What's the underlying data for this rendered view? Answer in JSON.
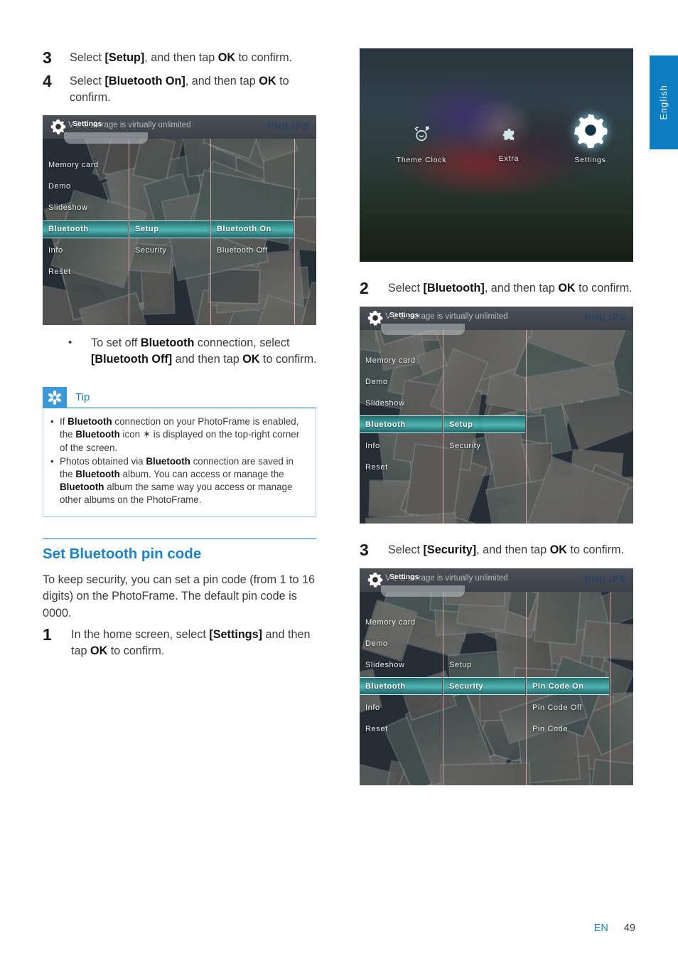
{
  "language_tab": {
    "label": "English"
  },
  "footer": {
    "lang_code": "EN",
    "page_number": "49"
  },
  "left_column": {
    "steps": [
      {
        "num": "3",
        "html": "Select <b>[Setup]</b>, and then tap <b>OK</b> to confirm."
      },
      {
        "num": "4",
        "html": "Select <b>[Bluetooth On]</b>, and then tap <b>OK</b> to confirm."
      }
    ],
    "screenshot_1": {
      "titlebar": {
        "background_text": "V      2 S        storage is virtually unlimited",
        "breadcrumb": "Settings",
        "brand": "PHILIPS",
        "icon": "gear-icon"
      },
      "column_1": [
        "Memory card",
        "Demo",
        "Slideshow",
        "Bluetooth",
        "Info",
        "Reset"
      ],
      "column_1_selected": "Bluetooth",
      "column_2": [
        "Setup",
        "Security"
      ],
      "column_2_selected": "Setup",
      "column_3": [
        "Bluetooth On",
        "Bluetooth Off"
      ],
      "column_3_selected": "Bluetooth On"
    },
    "sub_bullet": {
      "marker": "•",
      "html": "To set off <b>Bluetooth</b> connection, select <b>[Bluetooth Off]</b> and then tap <b>OK</b> to confirm."
    },
    "tip": {
      "icon": "asterisk-icon",
      "title": "Tip",
      "items": [
        "If <b>Bluetooth</b> connection on your PhotoFrame is enabled, the <b>Bluetooth</b> icon ✶ is displayed on the top-right corner of the screen.",
        "Photos obtained via <b>Bluetooth</b> connection are saved in the <b>Bluetooth</b> album. You can access or manage the <b>Bluetooth</b> album the same way you access or manage other albums on the PhotoFrame."
      ]
    },
    "section": {
      "title": "Set Bluetooth pin code",
      "paragraph": "To keep security, you can set a pin code (from 1 to 16 digits) on the PhotoFrame. The default pin code is 0000.",
      "steps": [
        {
          "num": "1",
          "html": "In the home screen, select <b>[Settings]</b> and then tap <b>OK</b> to confirm."
        }
      ]
    }
  },
  "right_column": {
    "home_screen": {
      "icons": [
        {
          "label": "Theme Clock",
          "icon": "alarm-clock-icon",
          "selected": false
        },
        {
          "label": "Extra",
          "icon": "puzzle-piece-icon",
          "selected": false
        },
        {
          "label": "Settings",
          "icon": "gear-icon",
          "selected": true
        }
      ]
    },
    "steps": [
      {
        "num": "2",
        "html": "Select <b>[Bluetooth]</b>, and then tap <b>OK</b> to confirm."
      },
      {
        "num": "3",
        "html": "Select <b>[Security]</b>, and then tap <b>OK</b> to confirm."
      }
    ],
    "screenshot_2": {
      "titlebar": {
        "background_text": "V      2 S        storage is virtually unlimited",
        "breadcrumb": "Settings",
        "brand": "PHILIPS",
        "icon": "gear-icon"
      },
      "column_1": [
        "Memory card",
        "Demo",
        "Slideshow",
        "Bluetooth",
        "Info",
        "Reset"
      ],
      "column_1_selected": "Bluetooth",
      "column_2": [
        "Setup",
        "Security"
      ],
      "column_2_selected": "Setup"
    },
    "screenshot_3": {
      "titlebar": {
        "background_text": "V      2 S        storage is virtually unlimited",
        "breadcrumb": "Settings",
        "brand": "PHILIPS",
        "icon": "gear-icon"
      },
      "column_1": [
        "Memory card",
        "Demo",
        "Slideshow",
        "Bluetooth",
        "Info",
        "Reset"
      ],
      "column_1_selected": "Bluetooth",
      "column_2": [
        "Setup",
        "Security"
      ],
      "column_2_selected": "Security",
      "column_3": [
        "Pin Code On",
        "Pin Code Off",
        "Pin Code"
      ],
      "column_3_selected": "Pin Code On"
    }
  },
  "colors": {
    "accent_blue": "#1985c8",
    "tab_blue": "#0f7dc2",
    "tip_icon_blue": "#3a9ad9",
    "highlight_teal": "#4cc4c0",
    "philips_navy": "#2c3f66"
  }
}
